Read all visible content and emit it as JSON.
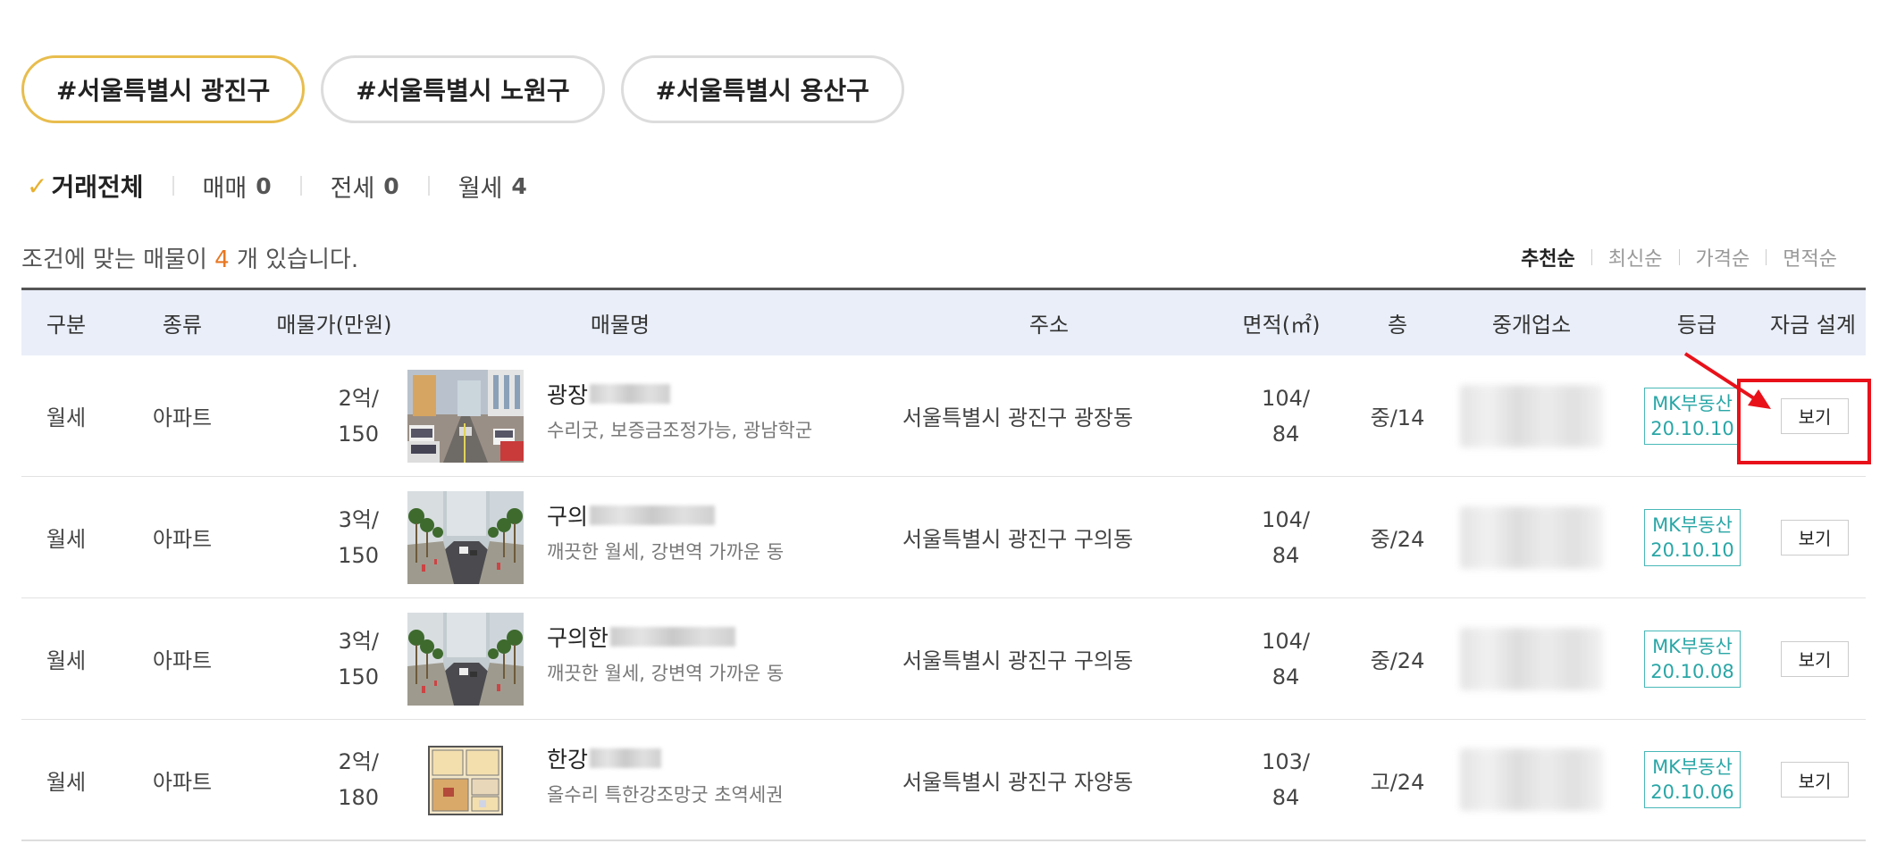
{
  "region_tags": [
    {
      "label": "#서울특별시 광진구",
      "active": true
    },
    {
      "label": "#서울특별시 노원구",
      "active": false
    },
    {
      "label": "#서울특별시 용산구",
      "active": false
    }
  ],
  "deal_tabs": {
    "all": "거래전체",
    "sale": {
      "label": "매매",
      "count": "0"
    },
    "jeonse": {
      "label": "전세",
      "count": "0"
    },
    "monthly": {
      "label": "월세",
      "count": "4"
    }
  },
  "result": {
    "prefix": "조건에 맞는 매물이 ",
    "count": "4",
    "suffix": " 개 있습니다."
  },
  "sort_options": [
    "추천순",
    "최신순",
    "가격순",
    "면적순"
  ],
  "table": {
    "headers": {
      "category": "구분",
      "type": "종류",
      "price": "매물가(만원)",
      "name": "매물명",
      "address": "주소",
      "area": "면적(㎡)",
      "floor": "층",
      "agent": "중개업소",
      "grade": "등급",
      "finance": "자금 설계"
    },
    "rows": [
      {
        "category": "월세",
        "type": "아파트",
        "price_top": "2억/",
        "price_bottom": "150",
        "name_prefix": "광장",
        "desc": "수리굿, 보증금조정가능, 광남학군",
        "address": "서울특별시 광진구 광장동",
        "area_top": "104/",
        "area_bottom": "84",
        "floor": "중/14",
        "grade_line1": "MK부동산",
        "grade_line2": "20.10.10",
        "button": "보기",
        "thumb": "street"
      },
      {
        "category": "월세",
        "type": "아파트",
        "price_top": "3억/",
        "price_bottom": "150",
        "name_prefix": "구의",
        "desc": "깨끗한 월세, 강변역 가까운 동",
        "address": "서울특별시 광진구 구의동",
        "area_top": "104/",
        "area_bottom": "84",
        "floor": "중/24",
        "grade_line1": "MK부동산",
        "grade_line2": "20.10.10",
        "button": "보기",
        "thumb": "trees"
      },
      {
        "category": "월세",
        "type": "아파트",
        "price_top": "3억/",
        "price_bottom": "150",
        "name_prefix": "구의한",
        "desc": "깨끗한 월세, 강변역 가까운 동",
        "address": "서울특별시 광진구 구의동",
        "area_top": "104/",
        "area_bottom": "84",
        "floor": "중/24",
        "grade_line1": "MK부동산",
        "grade_line2": "20.10.08",
        "button": "보기",
        "thumb": "trees"
      },
      {
        "category": "월세",
        "type": "아파트",
        "price_top": "2억/",
        "price_bottom": "180",
        "name_prefix": "한강",
        "desc": "올수리 특한강조망굿 초역세권",
        "address": "서울특별시 광진구 자양동",
        "area_top": "103/",
        "area_bottom": "84",
        "floor": "고/24",
        "grade_line1": "MK부동산",
        "grade_line2": "20.10.06",
        "button": "보기",
        "thumb": "floorplan"
      }
    ]
  },
  "colors": {
    "active_tag_border": "#e8bd4e",
    "count_accent": "#e87722",
    "header_bg": "#e9eef8",
    "grade_teal": "#2aa6a6",
    "annotation_red": "#e8111a"
  }
}
